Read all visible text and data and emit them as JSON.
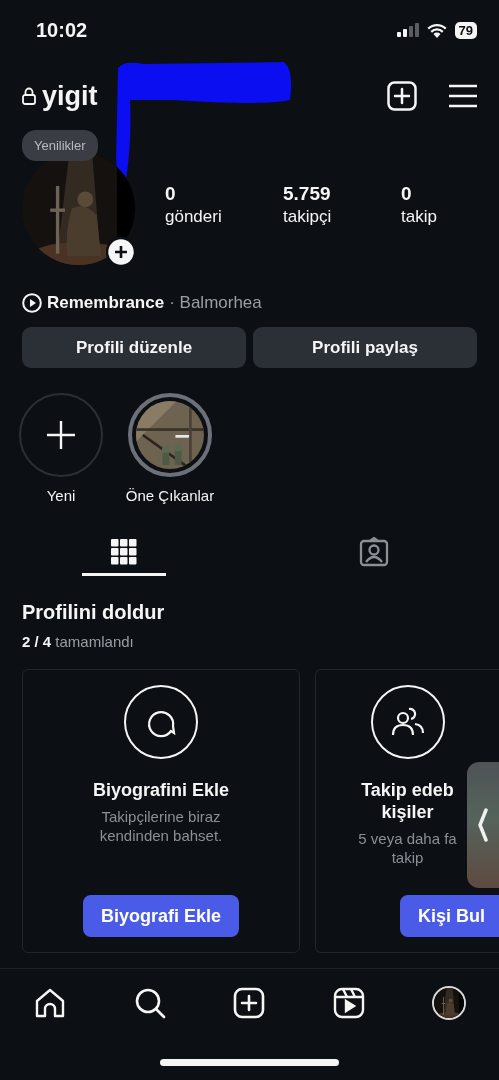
{
  "status_bar": {
    "time": "10:02",
    "battery": "79"
  },
  "header": {
    "username": "yigit"
  },
  "profile": {
    "tooltip": "Yenilikler",
    "stats": [
      {
        "value": "0",
        "label": "gönderi"
      },
      {
        "value": "5.759",
        "label": "takipçi"
      },
      {
        "value": "0",
        "label": "takip"
      }
    ]
  },
  "music": {
    "title": "Remembrance",
    "artist": "· Balmorhea"
  },
  "buttons": [
    "Profili düzenle",
    "Profili paylaş"
  ],
  "highlights": [
    {
      "kind": "new",
      "label": "Yeni"
    },
    {
      "kind": "picture",
      "label": "Öne Çıkanlar"
    }
  ],
  "tabs": [
    {
      "kind": "grid",
      "selected": true
    },
    {
      "kind": "tagged",
      "selected": false
    }
  ],
  "completion": {
    "title": "Profilini doldur",
    "progress": "2 / 4",
    "progress_label": "tamamlandı"
  },
  "cards": [
    {
      "kind": "bio",
      "title_lines": [
        "Biyografini Ekle"
      ],
      "text_lines": [
        "Takipçilerine biraz",
        "kendinden bahset."
      ],
      "button": "Biyografi Ekle"
    },
    {
      "kind": "people",
      "title_lines": [
        "Takip edeb",
        "kişiler"
      ],
      "text_lines": [
        "5 veya daha fa",
        "takip"
      ],
      "button": "Kişi Bul"
    }
  ],
  "nav": [
    {
      "kind": "home"
    },
    {
      "kind": "search"
    },
    {
      "kind": "create"
    },
    {
      "kind": "reels"
    },
    {
      "kind": "profile"
    }
  ]
}
